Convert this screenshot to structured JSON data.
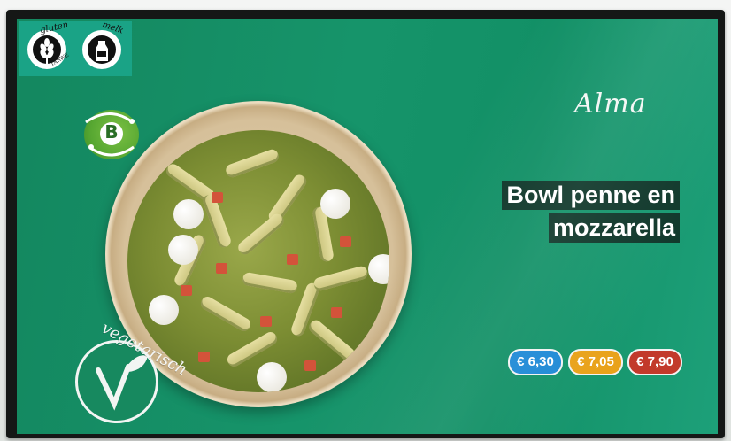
{
  "allergens": {
    "gluten_label": "gluten",
    "gluten_sub": "TARWE",
    "milk_label": "melk"
  },
  "bio_badge": {
    "letter": "B"
  },
  "brand": "Alma",
  "dish": {
    "title_lines": [
      "Bowl penne en",
      "mozzarella"
    ]
  },
  "prices": [
    {
      "label": "€ 6,30",
      "color": "#1f8ad6"
    },
    {
      "label": "€ 7,05",
      "color": "#e9a21a"
    },
    {
      "label": "€ 7,90",
      "color": "#c23a2b"
    }
  ],
  "vegetarian": {
    "label": "vegetarisch"
  },
  "colors": {
    "screen_bg": "#16946a",
    "title_bg": "#10382b"
  }
}
